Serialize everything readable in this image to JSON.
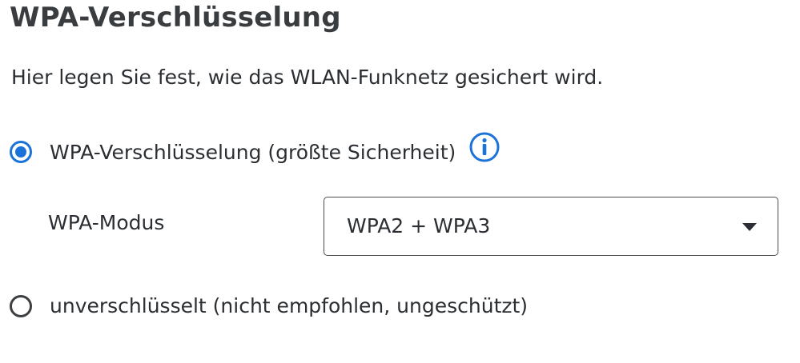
{
  "section": {
    "title": "WPA-Verschlüsselung",
    "description": "Hier legen Sie fest, wie das WLAN-Funknetz gesichert wird."
  },
  "options": [
    {
      "label": "WPA-Verschlüsselung (größte Sicherheit)",
      "selected": true,
      "icon": "info-icon"
    },
    {
      "label": "unverschlüsselt (nicht empfohlen, ungeschützt)",
      "selected": false
    }
  ],
  "wpa_mode": {
    "label": "WPA-Modus",
    "selected_value": "WPA2 + WPA3",
    "icon": "chevron-down-icon"
  },
  "colors": {
    "accent": "#1a73d9",
    "text": "#2b2f33",
    "heading": "#3a3d40"
  }
}
